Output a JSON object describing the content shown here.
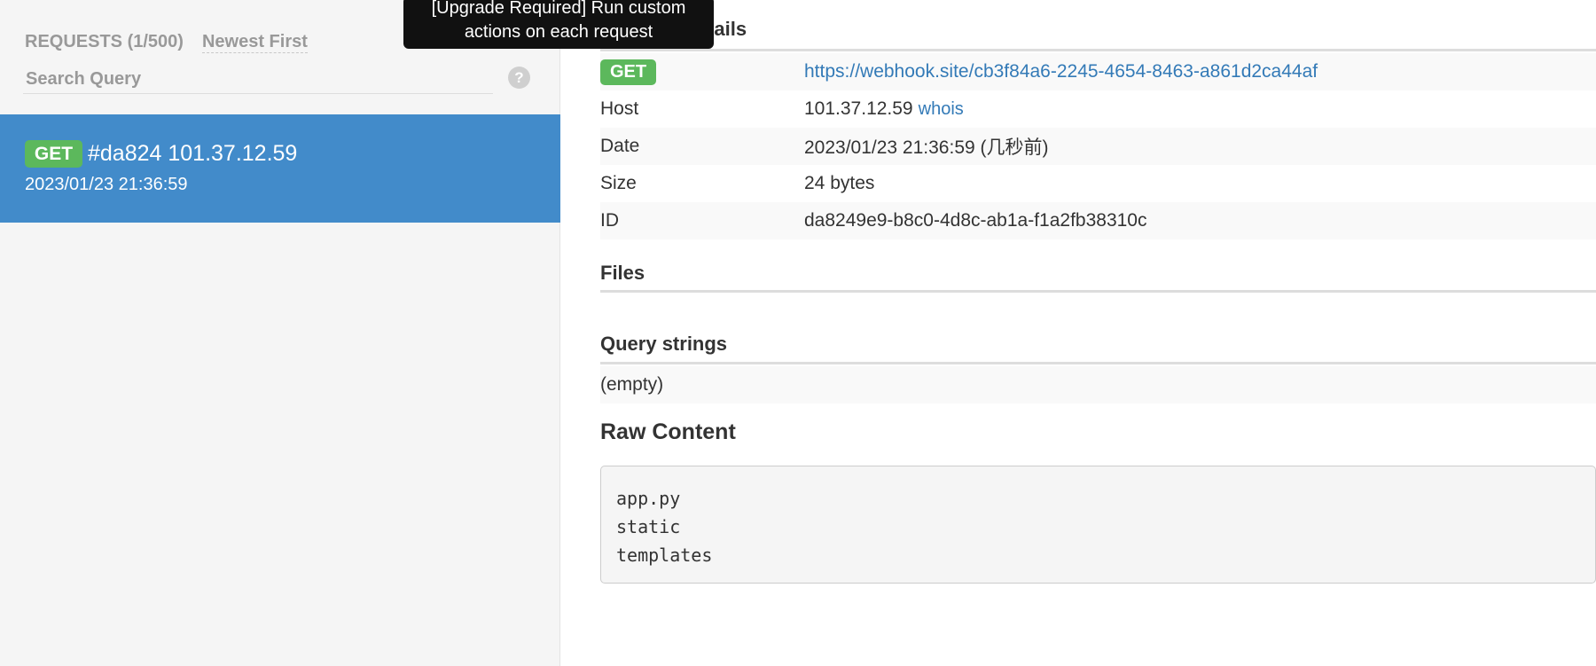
{
  "sidebar": {
    "header_label": "REQUESTS (1/500)",
    "sort_label": "Newest First",
    "search_placeholder": "Search Query",
    "help_glyph": "?",
    "request": {
      "method": "GET",
      "title": "#da824 101.37.12.59",
      "date": "2023/01/23 21:36:59"
    }
  },
  "tooltip": {
    "line1": "[Upgrade Required] Run custom",
    "line2": "actions on each request"
  },
  "details": {
    "title": "Request Details",
    "method": "GET",
    "url": "https://webhook.site/cb3f84a6-2245-4654-8463-a861d2ca44af",
    "rows": {
      "host_label": "Host",
      "host_value": "101.37.12.59",
      "whois_label": "whois",
      "date_label": "Date",
      "date_value": "2023/01/23 21:36:59 (几秒前)",
      "size_label": "Size",
      "size_value": "24 bytes",
      "id_label": "ID",
      "id_value": "da8249e9-b8c0-4d8c-ab1a-f1a2fb38310c"
    }
  },
  "files": {
    "title": "Files"
  },
  "query_strings": {
    "title": "Query strings",
    "empty_label": "(empty)"
  },
  "raw_content": {
    "title": "Raw Content",
    "text": "app.py\nstatic\ntemplates"
  },
  "colors": {
    "accent_blue": "#428bca",
    "badge_green": "#5cb85c",
    "link_blue": "#337ab7",
    "tooltip_bg": "#111111"
  }
}
